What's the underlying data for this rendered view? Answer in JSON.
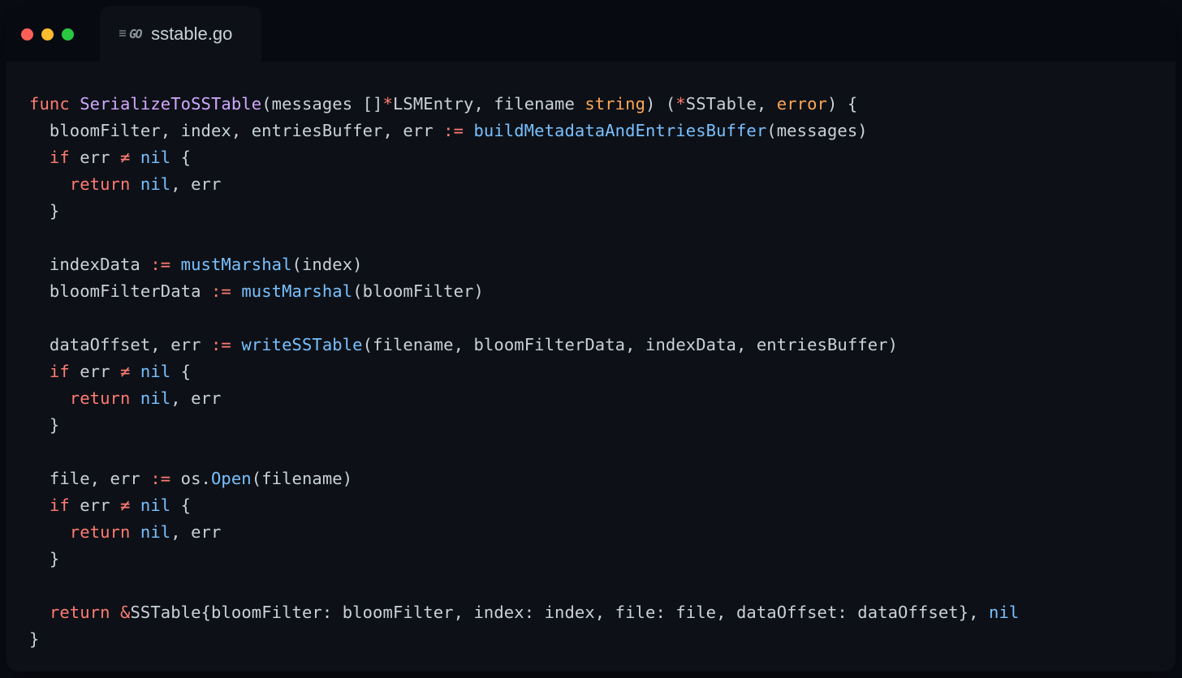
{
  "tab": {
    "filename": "sstable.go",
    "icon_label": "GO"
  },
  "colors": {
    "background": "#0d1117",
    "titlebar": "#080a12",
    "keyword": "#ff7b72",
    "function_decl": "#d2a8ff",
    "function_call": "#79c0ff",
    "type": "#ffa657",
    "nil": "#79c0ff",
    "text": "#c9d1d9",
    "traffic_red": "#ff5f57",
    "traffic_yellow": "#febc2e",
    "traffic_green": "#28c840"
  },
  "code": {
    "lines": [
      [
        {
          "cls": "kw",
          "t": "func "
        },
        {
          "cls": "fn",
          "t": "SerializeToSSTable"
        },
        {
          "cls": "pun",
          "t": "(messages []"
        },
        {
          "cls": "op",
          "t": "*"
        },
        {
          "cls": "id",
          "t": "LSMEntry, filename "
        },
        {
          "cls": "typ",
          "t": "string"
        },
        {
          "cls": "pun",
          "t": ") ("
        },
        {
          "cls": "op",
          "t": "*"
        },
        {
          "cls": "id",
          "t": "SSTable, "
        },
        {
          "cls": "typ",
          "t": "error"
        },
        {
          "cls": "pun",
          "t": ") {"
        }
      ],
      [
        {
          "cls": "id",
          "t": "  bloomFilter, index, entriesBuffer, err "
        },
        {
          "cls": "op",
          "t": ":="
        },
        {
          "cls": "id",
          "t": " "
        },
        {
          "cls": "call",
          "t": "buildMetadataAndEntriesBuffer"
        },
        {
          "cls": "pun",
          "t": "(messages)"
        }
      ],
      [
        {
          "cls": "id",
          "t": "  "
        },
        {
          "cls": "kw",
          "t": "if"
        },
        {
          "cls": "id",
          "t": " err "
        },
        {
          "cls": "op",
          "t": "≠"
        },
        {
          "cls": "id",
          "t": " "
        },
        {
          "cls": "nilv",
          "t": "nil"
        },
        {
          "cls": "pun",
          "t": " {"
        }
      ],
      [
        {
          "cls": "id",
          "t": "    "
        },
        {
          "cls": "kw",
          "t": "return"
        },
        {
          "cls": "id",
          "t": " "
        },
        {
          "cls": "nilv",
          "t": "nil"
        },
        {
          "cls": "pun",
          "t": ", err"
        }
      ],
      [
        {
          "cls": "pun",
          "t": "  }"
        }
      ],
      [
        {
          "cls": "pun",
          "t": ""
        }
      ],
      [
        {
          "cls": "id",
          "t": "  indexData "
        },
        {
          "cls": "op",
          "t": ":="
        },
        {
          "cls": "id",
          "t": " "
        },
        {
          "cls": "call",
          "t": "mustMarshal"
        },
        {
          "cls": "pun",
          "t": "(index)"
        }
      ],
      [
        {
          "cls": "id",
          "t": "  bloomFilterData "
        },
        {
          "cls": "op",
          "t": ":="
        },
        {
          "cls": "id",
          "t": " "
        },
        {
          "cls": "call",
          "t": "mustMarshal"
        },
        {
          "cls": "pun",
          "t": "(bloomFilter)"
        }
      ],
      [
        {
          "cls": "pun",
          "t": ""
        }
      ],
      [
        {
          "cls": "id",
          "t": "  dataOffset, err "
        },
        {
          "cls": "op",
          "t": ":="
        },
        {
          "cls": "id",
          "t": " "
        },
        {
          "cls": "call",
          "t": "writeSSTable"
        },
        {
          "cls": "pun",
          "t": "(filename, bloomFilterData, indexData, entriesBuffer)"
        }
      ],
      [
        {
          "cls": "id",
          "t": "  "
        },
        {
          "cls": "kw",
          "t": "if"
        },
        {
          "cls": "id",
          "t": " err "
        },
        {
          "cls": "op",
          "t": "≠"
        },
        {
          "cls": "id",
          "t": " "
        },
        {
          "cls": "nilv",
          "t": "nil"
        },
        {
          "cls": "pun",
          "t": " {"
        }
      ],
      [
        {
          "cls": "id",
          "t": "    "
        },
        {
          "cls": "kw",
          "t": "return"
        },
        {
          "cls": "id",
          "t": " "
        },
        {
          "cls": "nilv",
          "t": "nil"
        },
        {
          "cls": "pun",
          "t": ", err"
        }
      ],
      [
        {
          "cls": "pun",
          "t": "  }"
        }
      ],
      [
        {
          "cls": "pun",
          "t": ""
        }
      ],
      [
        {
          "cls": "id",
          "t": "  file, err "
        },
        {
          "cls": "op",
          "t": ":="
        },
        {
          "cls": "id",
          "t": " os."
        },
        {
          "cls": "call",
          "t": "Open"
        },
        {
          "cls": "pun",
          "t": "(filename)"
        }
      ],
      [
        {
          "cls": "id",
          "t": "  "
        },
        {
          "cls": "kw",
          "t": "if"
        },
        {
          "cls": "id",
          "t": " err "
        },
        {
          "cls": "op",
          "t": "≠"
        },
        {
          "cls": "id",
          "t": " "
        },
        {
          "cls": "nilv",
          "t": "nil"
        },
        {
          "cls": "pun",
          "t": " {"
        }
      ],
      [
        {
          "cls": "id",
          "t": "    "
        },
        {
          "cls": "kw",
          "t": "return"
        },
        {
          "cls": "id",
          "t": " "
        },
        {
          "cls": "nilv",
          "t": "nil"
        },
        {
          "cls": "pun",
          "t": ", err"
        }
      ],
      [
        {
          "cls": "pun",
          "t": "  }"
        }
      ],
      [
        {
          "cls": "pun",
          "t": ""
        }
      ],
      [
        {
          "cls": "id",
          "t": "  "
        },
        {
          "cls": "kw",
          "t": "return"
        },
        {
          "cls": "id",
          "t": " "
        },
        {
          "cls": "op",
          "t": "&"
        },
        {
          "cls": "id",
          "t": "SSTable{bloomFilter: bloomFilter, index: index, file: file, dataOffset: dataOffset}, "
        },
        {
          "cls": "nilv",
          "t": "nil"
        }
      ],
      [
        {
          "cls": "pun",
          "t": "}"
        }
      ]
    ]
  }
}
